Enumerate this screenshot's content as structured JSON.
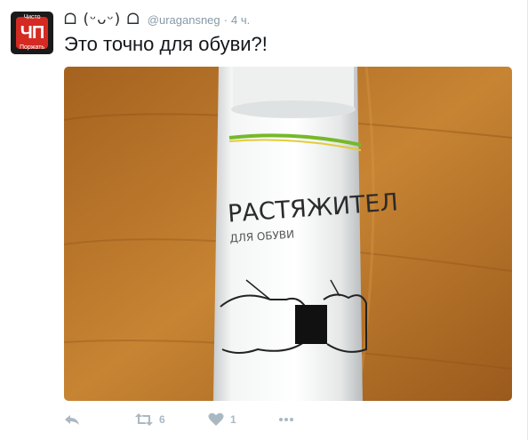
{
  "tweet": {
    "avatar": {
      "monogram": "ЧП",
      "top_text": "Чисто",
      "bottom_text": "Поржать"
    },
    "display_name": "ᗝ (ᵕᴗᵕ) ᗝ",
    "handle": "@uragansneg",
    "separator": "·",
    "timestamp": "4 ч.",
    "text": "Это точно для обуви?!",
    "media": {
      "can_title": "РАСТЯЖИТЕЛ",
      "can_subtitle": "ДЛЯ ОБУВИ"
    },
    "actions": {
      "retweet_count": "6",
      "like_count": "1"
    }
  },
  "colors": {
    "icon": "#aab8c2",
    "muted_text": "#8899a6",
    "text": "#14171a"
  }
}
